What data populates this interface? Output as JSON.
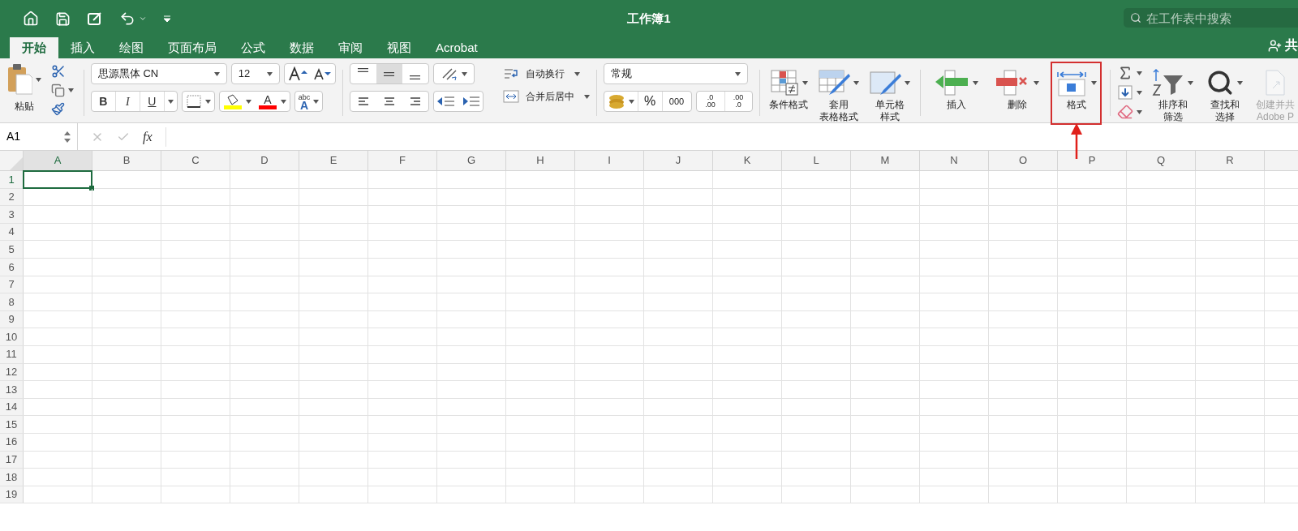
{
  "window": {
    "title": "工作簿1"
  },
  "search": {
    "placeholder": "在工作表中搜索"
  },
  "share": {
    "label": "共"
  },
  "tabs": [
    {
      "label": "开始",
      "selected": true
    },
    {
      "label": "插入",
      "selected": false
    },
    {
      "label": "绘图",
      "selected": false
    },
    {
      "label": "页面布局",
      "selected": false
    },
    {
      "label": "公式",
      "selected": false
    },
    {
      "label": "数据",
      "selected": false
    },
    {
      "label": "审阅",
      "selected": false
    },
    {
      "label": "视图",
      "selected": false
    },
    {
      "label": "Acrobat",
      "selected": false
    }
  ],
  "clipboard": {
    "paste_label": "粘贴"
  },
  "font": {
    "name": "思源黑体 CN",
    "size": "12",
    "styles": [
      "B",
      "I",
      "U"
    ],
    "fill": {
      "color": "#ffff00"
    },
    "font_color": {
      "glyph": "A",
      "color": "#ff0000"
    },
    "phonetic": {
      "top": "abc",
      "bottom": "A"
    }
  },
  "vertical_align": [
    {
      "kind": "top",
      "selected": false
    },
    {
      "kind": "middle",
      "selected": true
    },
    {
      "kind": "bottom",
      "selected": false
    }
  ],
  "wrap": {
    "wrap_label": "自动换行",
    "merge_label": "合并后居中"
  },
  "number": {
    "format": "常规",
    "percent": "%",
    "comma": "000",
    "increase": [
      ".0",
      ".00"
    ],
    "decrease": [
      ".00",
      ".0"
    ]
  },
  "big_buttons": [
    {
      "kind": "conditional",
      "lines": [
        "条件格式"
      ],
      "highlighted": false,
      "disabled": false
    },
    {
      "kind": "table",
      "lines": [
        "套用",
        "表格格式"
      ],
      "highlighted": false,
      "disabled": false
    },
    {
      "kind": "styles",
      "lines": [
        "单元格",
        "样式"
      ],
      "highlighted": false,
      "disabled": false
    },
    {
      "kind": "insert",
      "lines": [
        "插入"
      ],
      "highlighted": false,
      "disabled": false
    },
    {
      "kind": "delete",
      "lines": [
        "删除"
      ],
      "highlighted": false,
      "disabled": false
    },
    {
      "kind": "format",
      "lines": [
        "格式"
      ],
      "highlighted": true,
      "disabled": false
    },
    {
      "kind": "sort",
      "lines": [
        "排序和",
        "筛选"
      ],
      "highlighted": false,
      "disabled": false
    },
    {
      "kind": "find",
      "lines": [
        "查找和",
        "选择"
      ],
      "highlighted": false,
      "disabled": false
    },
    {
      "kind": "pdf",
      "lines": [
        "创建并共",
        "Adobe P"
      ],
      "highlighted": false,
      "disabled": true
    }
  ],
  "formula_bar": {
    "name_box": "A1",
    "fx_label": "fx"
  },
  "columns": [
    {
      "label": "A",
      "selected": true
    },
    {
      "label": "B",
      "selected": false
    },
    {
      "label": "C",
      "selected": false
    },
    {
      "label": "D",
      "selected": false
    },
    {
      "label": "E",
      "selected": false
    },
    {
      "label": "F",
      "selected": false
    },
    {
      "label": "G",
      "selected": false
    },
    {
      "label": "H",
      "selected": false
    },
    {
      "label": "I",
      "selected": false
    },
    {
      "label": "J",
      "selected": false
    },
    {
      "label": "K",
      "selected": false
    },
    {
      "label": "L",
      "selected": false
    },
    {
      "label": "M",
      "selected": false
    },
    {
      "label": "N",
      "selected": false
    },
    {
      "label": "O",
      "selected": false
    },
    {
      "label": "P",
      "selected": false
    },
    {
      "label": "Q",
      "selected": false
    },
    {
      "label": "R",
      "selected": false
    }
  ],
  "rows": [
    {
      "label": "1",
      "selected": true
    },
    {
      "label": "2",
      "selected": false
    },
    {
      "label": "3",
      "selected": false
    },
    {
      "label": "4",
      "selected": false
    },
    {
      "label": "5",
      "selected": false
    },
    {
      "label": "6",
      "selected": false
    },
    {
      "label": "7",
      "selected": false
    },
    {
      "label": "8",
      "selected": false
    },
    {
      "label": "9",
      "selected": false
    },
    {
      "label": "10",
      "selected": false
    },
    {
      "label": "11",
      "selected": false
    },
    {
      "label": "12",
      "selected": false
    },
    {
      "label": "13",
      "selected": false
    },
    {
      "label": "14",
      "selected": false
    },
    {
      "label": "15",
      "selected": false
    },
    {
      "label": "16",
      "selected": false
    },
    {
      "label": "17",
      "selected": false
    },
    {
      "label": "18",
      "selected": false
    },
    {
      "label": "19",
      "selected": false
    }
  ]
}
